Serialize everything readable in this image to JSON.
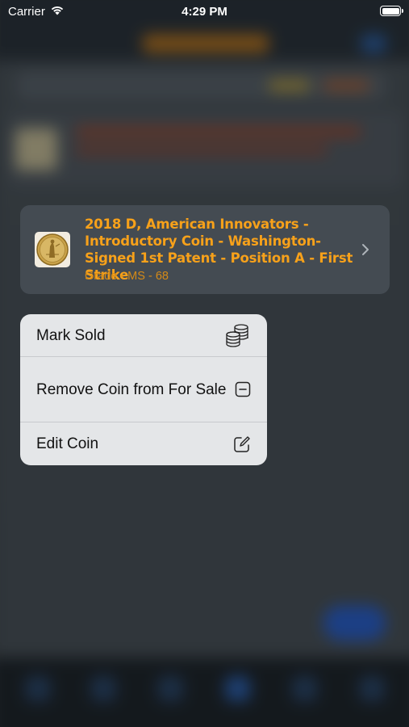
{
  "status_bar": {
    "carrier": "Carrier",
    "time": "4:29 PM"
  },
  "coin_card": {
    "title": "2018 D, American Innovators - Introductory Coin - Washington-Signed 1st Patent - Position A - First Strike",
    "grade": "Grade - MS - 68",
    "title_color": "#f7a11a",
    "thumbnail_icon": "coin-icon",
    "accessory_icon": "chevron-right-icon"
  },
  "context_menu": {
    "items": [
      {
        "label": "Mark Sold",
        "icon": "coins-stack-icon"
      },
      {
        "label": "Remove Coin from For Sale",
        "icon": "minus-square-icon"
      },
      {
        "label": "Edit Coin",
        "icon": "edit-square-icon"
      }
    ]
  }
}
